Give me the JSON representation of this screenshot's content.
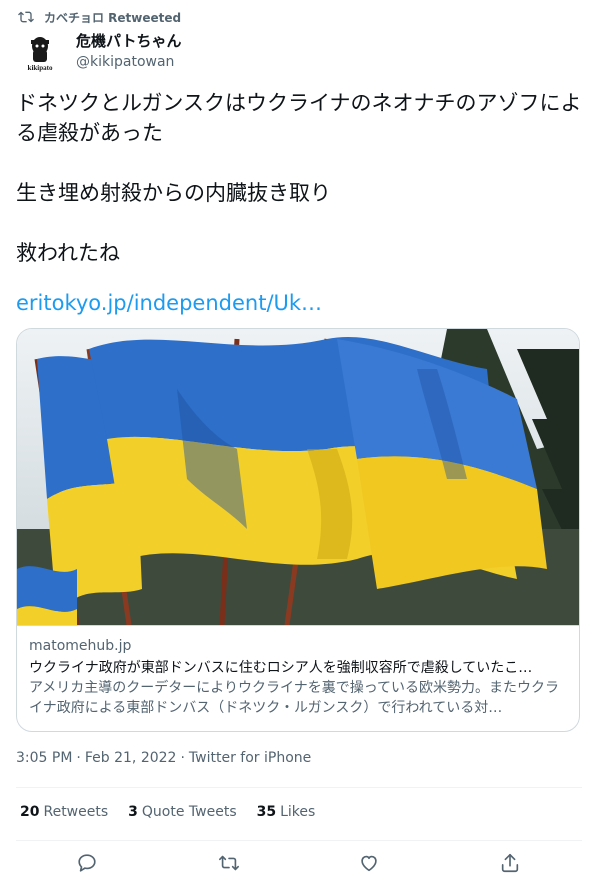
{
  "retweet_banner": {
    "text": "カベチョロ Retweeted"
  },
  "author": {
    "display_name": "危機パトちゃん",
    "handle": "@kikipatowan",
    "avatar_label": "kikipato"
  },
  "tweet": {
    "line1": "ドネツクとルガンスクはウクライナのネオナチのアゾフによる虐殺があった",
    "line2": "生き埋め射殺からの内臓抜き取り",
    "line3": "救われたね",
    "link_text": "eritokyo.jp/independent/Uk…"
  },
  "card": {
    "domain": "matomehub.jp",
    "title": "ウクライナ政府が東部ドンバスに住むロシア人を強制収容所で虐殺していたこ…",
    "description": "アメリカ主導のクーデターによりウクライナを裏で操っている欧米勢力。またウクライナ政府による東部ドンバス（ドネツク・ルガンスク）で行われている対…"
  },
  "meta": {
    "time": "3:05 PM",
    "separator1": "·",
    "date": "Feb 21, 2022",
    "separator2": "·",
    "source": "Twitter for iPhone"
  },
  "stats": {
    "retweets_count": "20",
    "retweets_label": "Retweets",
    "quotes_count": "3",
    "quotes_label": "Quote Tweets",
    "likes_count": "35",
    "likes_label": "Likes"
  },
  "icons": {
    "retweet": "retweet-icon",
    "reply": "reply-icon",
    "like": "heart-icon",
    "share": "share-icon"
  },
  "colors": {
    "link": "#1d9bf0",
    "secondary_text": "#536471",
    "flag_blue": "#2d6fc9",
    "flag_yellow": "#f3cf2a"
  }
}
